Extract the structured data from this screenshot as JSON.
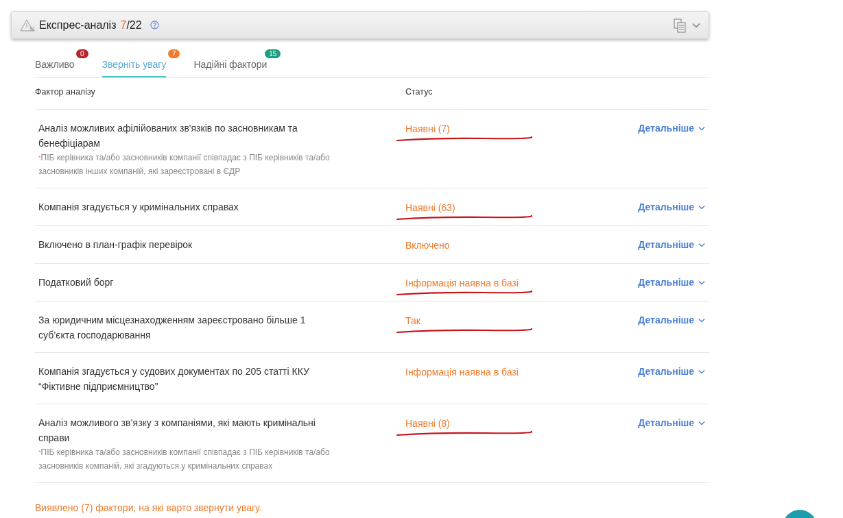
{
  "header": {
    "title": "Експрес-аналіз",
    "found": "7",
    "total": "/22"
  },
  "tabs": [
    {
      "label": "Важливо",
      "selected": false,
      "badge": "0",
      "color": "#b3262e"
    },
    {
      "label": "Зверніть увагу",
      "selected": true,
      "badge": "7",
      "color": "#f07c2a"
    },
    {
      "label": "Надійні фактори",
      "selected": false,
      "badge": "15",
      "color": "#1a9e7e"
    }
  ],
  "table": {
    "columns": [
      "Фактор аналізу",
      "Статус"
    ],
    "rows": [
      {
        "factor": "Аналіз можливих афілійованих зв'язків по засновникам та бенефіціарам",
        "note_mark": "*",
        "note": "ПІБ керівника та/або засновників компанії співпадає з ПІБ керівників та/або засновників інших компаній, які зареєстровані в ЄДР",
        "status": "Наявні (7)",
        "details": "Детальніше",
        "underlined": true
      },
      {
        "factor": "Компанія згадується у кримінальних справах",
        "status": "Наявні (63)",
        "details": "Детальніше",
        "underlined": true
      },
      {
        "factor": "Включено в план-графік перевірок",
        "status": "Включено",
        "details": "Детальніше",
        "underlined": false
      },
      {
        "factor": "Податковий борг",
        "status": "Інформація наявна в базі",
        "details": "Детальніше",
        "underlined": true
      },
      {
        "factor": "За юридичним місцезнаходженням зареєстровано більше 1 суб’єкта господарювання",
        "status": "Так",
        "details": "Детальніше",
        "underlined": true
      },
      {
        "factor": "Компанія згадується у судових документах по 205 статті ККУ “Фіктивне підприємництво”",
        "status": "Інформація наявна в базі",
        "details": "Детальніше",
        "underlined": false
      },
      {
        "factor": "Аналіз можливого зв’язку з компаніями, які мають кримінальні справи",
        "note_mark": "*",
        "note": "ПІБ керівника та/або засновників компанії співпадає з ПІБ керівників та/або засновників компаній, які згадуються у кримінальних справах",
        "status": "Наявні (8)",
        "details": "Детальніше",
        "underlined": true
      }
    ]
  },
  "summary": "Виявлено (7) фактори, на які варто звернути увагу."
}
